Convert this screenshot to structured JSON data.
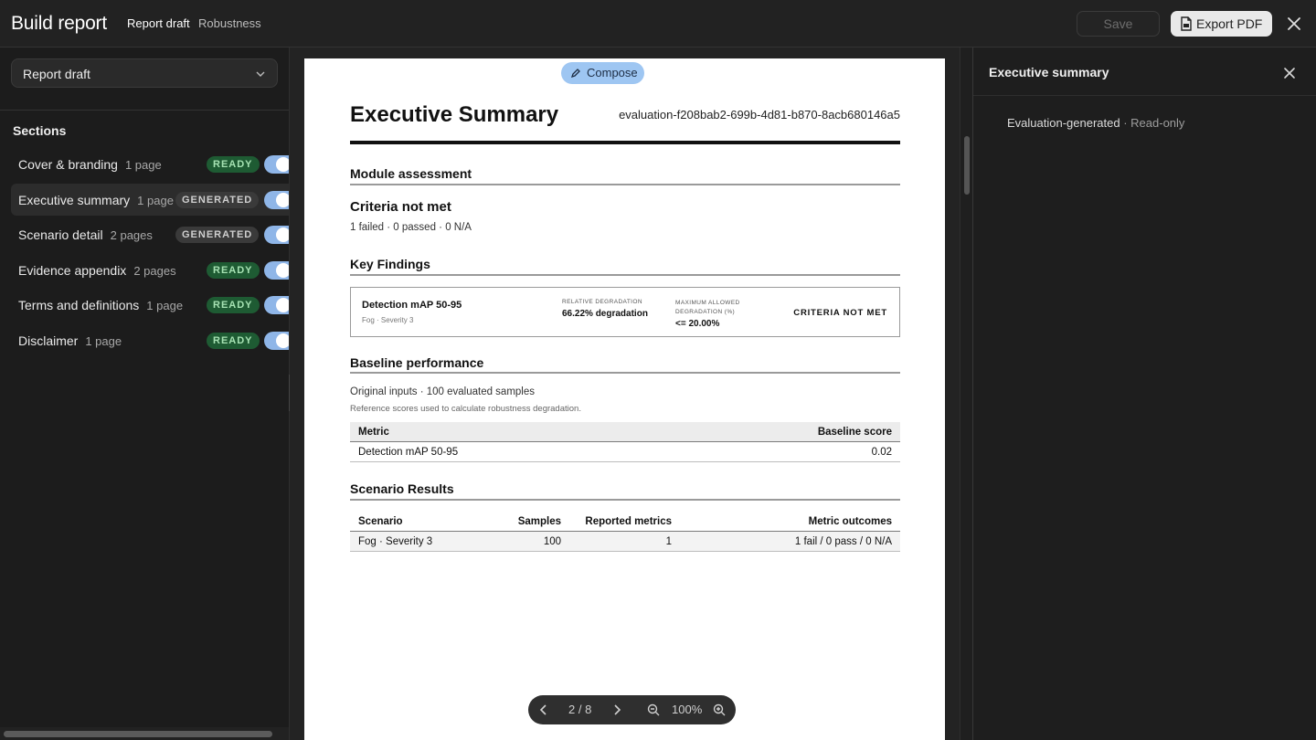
{
  "header": {
    "title": "Build report",
    "breadcrumbs": [
      "Report draft",
      "Robustness"
    ],
    "save_label": "Save",
    "export_label": "Export PDF"
  },
  "sidebar": {
    "draft_select": "Report draft",
    "sections_title": "Sections",
    "items": [
      {
        "label": "Cover & branding",
        "pages": "1 page",
        "status": "READY",
        "enabled": true
      },
      {
        "label": "Executive summary",
        "pages": "1 page",
        "status": "GENERATED",
        "enabled": true,
        "active": true
      },
      {
        "label": "Scenario detail",
        "pages": "2 pages",
        "status": "GENERATED",
        "enabled": true
      },
      {
        "label": "Evidence appendix",
        "pages": "2 pages",
        "status": "READY",
        "enabled": true
      },
      {
        "label": "Terms and definitions",
        "pages": "1 page",
        "status": "READY",
        "enabled": true
      },
      {
        "label": "Disclaimer",
        "pages": "1 page",
        "status": "READY",
        "enabled": true
      }
    ]
  },
  "preview": {
    "compose_label": "Compose",
    "title": "Executive Summary",
    "evaluation_id": "evaluation-f208bab2-699b-4d81-b870-8acb680146a5",
    "module_assessment": {
      "heading": "Module assessment",
      "verdict": "Criteria not met",
      "summary": "1 failed · 0 passed · 0 N/A"
    },
    "key_findings": {
      "heading": "Key Findings",
      "metric": "Detection mAP 50-95",
      "scenario": "Fog · Severity 3",
      "relative_label": "RELATIVE DEGRADATION",
      "relative_value": "66.22% degradation",
      "max_label": "MAXIMUM ALLOWED DEGRADATION (%)",
      "max_value": "<= 20.00%",
      "status": "CRITERIA NOT MET"
    },
    "baseline": {
      "heading": "Baseline performance",
      "inputs": "Original inputs · 100 evaluated samples",
      "note": "Reference scores used to calculate robustness degradation.",
      "columns": [
        "Metric",
        "Baseline score"
      ],
      "rows": [
        [
          "Detection mAP 50-95",
          "0.02"
        ]
      ]
    },
    "scenario_results": {
      "heading": "Scenario Results",
      "columns": [
        "Scenario",
        "Samples",
        "Reported metrics",
        "Metric outcomes"
      ],
      "rows": [
        [
          "Fog · Severity 3",
          "100",
          "1",
          "1 fail / 0 pass / 0 N/A"
        ]
      ]
    },
    "pager": {
      "page": "2 / 8",
      "zoom": "100%"
    }
  },
  "right_panel": {
    "title": "Executive summary",
    "note_main": "Evaluation-generated",
    "note_sep": " · ",
    "note_muted": "Read-only"
  },
  "colors": {
    "ready_badge_bg": "#1e5b33",
    "ready_badge_text": "#a6e2b3",
    "toggle_on": "#8fb6e8",
    "compose_bg": "#9ec6f2"
  },
  "icons": [
    "file-pdf-icon",
    "close-icon",
    "chevron-down-icon",
    "pencil-icon",
    "chevron-left-icon",
    "chevron-right-icon",
    "zoom-out-icon",
    "zoom-in-icon"
  ]
}
